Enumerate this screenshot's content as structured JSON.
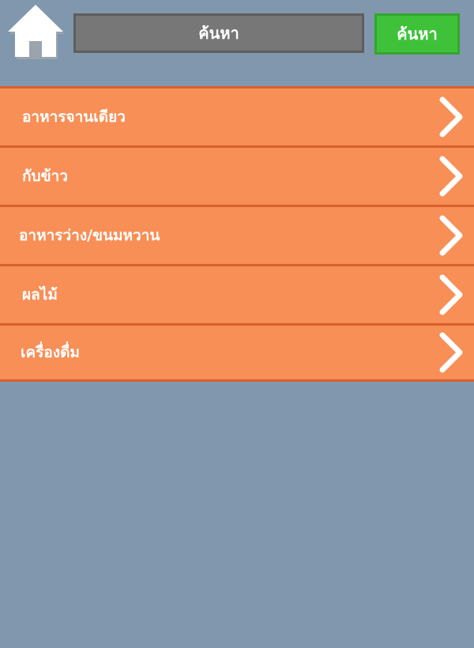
{
  "header": {
    "home_icon": "home-icon",
    "search_field_text": "ค้นหา",
    "search_button_label": "ค้นหา"
  },
  "categories": [
    {
      "label": "อาหารจานเดียว",
      "icon": "chevron-right-icon"
    },
    {
      "label": "กับข้าว",
      "icon": "chevron-right-icon"
    },
    {
      "label": "อาหารว่าง/ขนมหวาน",
      "icon": "chevron-right-icon"
    },
    {
      "label": "ผลไม้",
      "icon": "chevron-right-icon"
    },
    {
      "label": "เครื่องดื่ม",
      "icon": "chevron-right-icon"
    }
  ],
  "colors": {
    "background": "#8097ad",
    "menu_item": "#f78f57",
    "menu_border": "#d9602d",
    "search_box": "#777777",
    "search_button": "#3fc23a"
  }
}
